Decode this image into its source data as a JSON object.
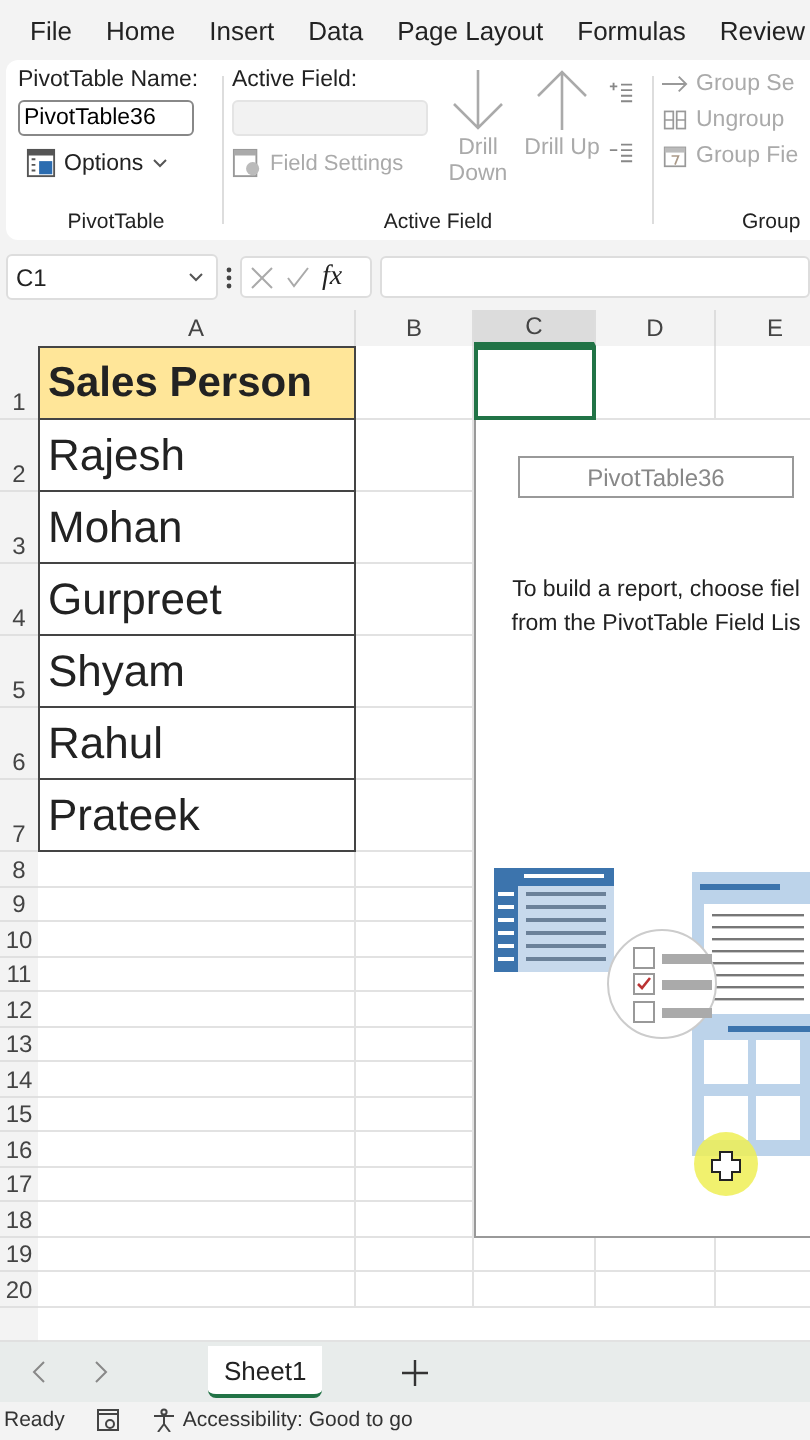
{
  "menu_tabs": [
    "File",
    "Home",
    "Insert",
    "Data",
    "Page Layout",
    "Formulas",
    "Review"
  ],
  "ribbon": {
    "pivottable": {
      "name_label": "PivotTable Name:",
      "name_value": "PivotTable36",
      "options_button": "Options",
      "group_label": "PivotTable"
    },
    "active_field": {
      "label": "Active Field:",
      "field_settings": {
        "label": "Field Settings",
        "disabled": true
      },
      "drill_down": {
        "label": "Drill Down",
        "disabled": true
      },
      "drill_up": {
        "label": "Drill Up",
        "disabled": true
      },
      "group_label": "Active Field"
    },
    "group": {
      "items": [
        {
          "label": "Group Se",
          "disabled": true
        },
        {
          "label": "Ungroup",
          "disabled": true
        },
        {
          "label": "Group Fie",
          "disabled": true
        }
      ],
      "group_label": "Group"
    }
  },
  "formula_bar": {
    "name_box": "C1",
    "function_label": "fx"
  },
  "columns": [
    {
      "label": "A",
      "selected": false
    },
    {
      "label": "B",
      "selected": false
    },
    {
      "label": "C",
      "selected": true
    },
    {
      "label": "D",
      "selected": false
    },
    {
      "label": "E",
      "selected": false
    }
  ],
  "rows": [
    {
      "number": "1",
      "cell_a": "Sales Person"
    },
    {
      "number": "2",
      "cell_a": "Rajesh"
    },
    {
      "number": "3",
      "cell_a": "Mohan"
    },
    {
      "number": "4",
      "cell_a": "Gurpreet"
    },
    {
      "number": "5",
      "cell_a": "Shyam"
    },
    {
      "number": "6",
      "cell_a": "Rahul"
    },
    {
      "number": "7",
      "cell_a": "Prateek"
    },
    {
      "number": "8"
    },
    {
      "number": "9"
    },
    {
      "number": "10"
    },
    {
      "number": "11"
    },
    {
      "number": "12"
    },
    {
      "number": "13"
    },
    {
      "number": "14"
    },
    {
      "number": "15"
    },
    {
      "number": "16"
    },
    {
      "number": "17"
    },
    {
      "number": "18"
    },
    {
      "number": "19"
    },
    {
      "number": "20"
    }
  ],
  "pivot_placeholder": {
    "name": "PivotTable36",
    "instructions": [
      "To build a report, choose fiel",
      "from the PivotTable Field Lis"
    ]
  },
  "sheet_tabs": [
    {
      "label": "Sheet1",
      "selected": true
    }
  ],
  "status_bar": {
    "mode": "Ready",
    "accessibility": "Accessibility: Good to go"
  }
}
